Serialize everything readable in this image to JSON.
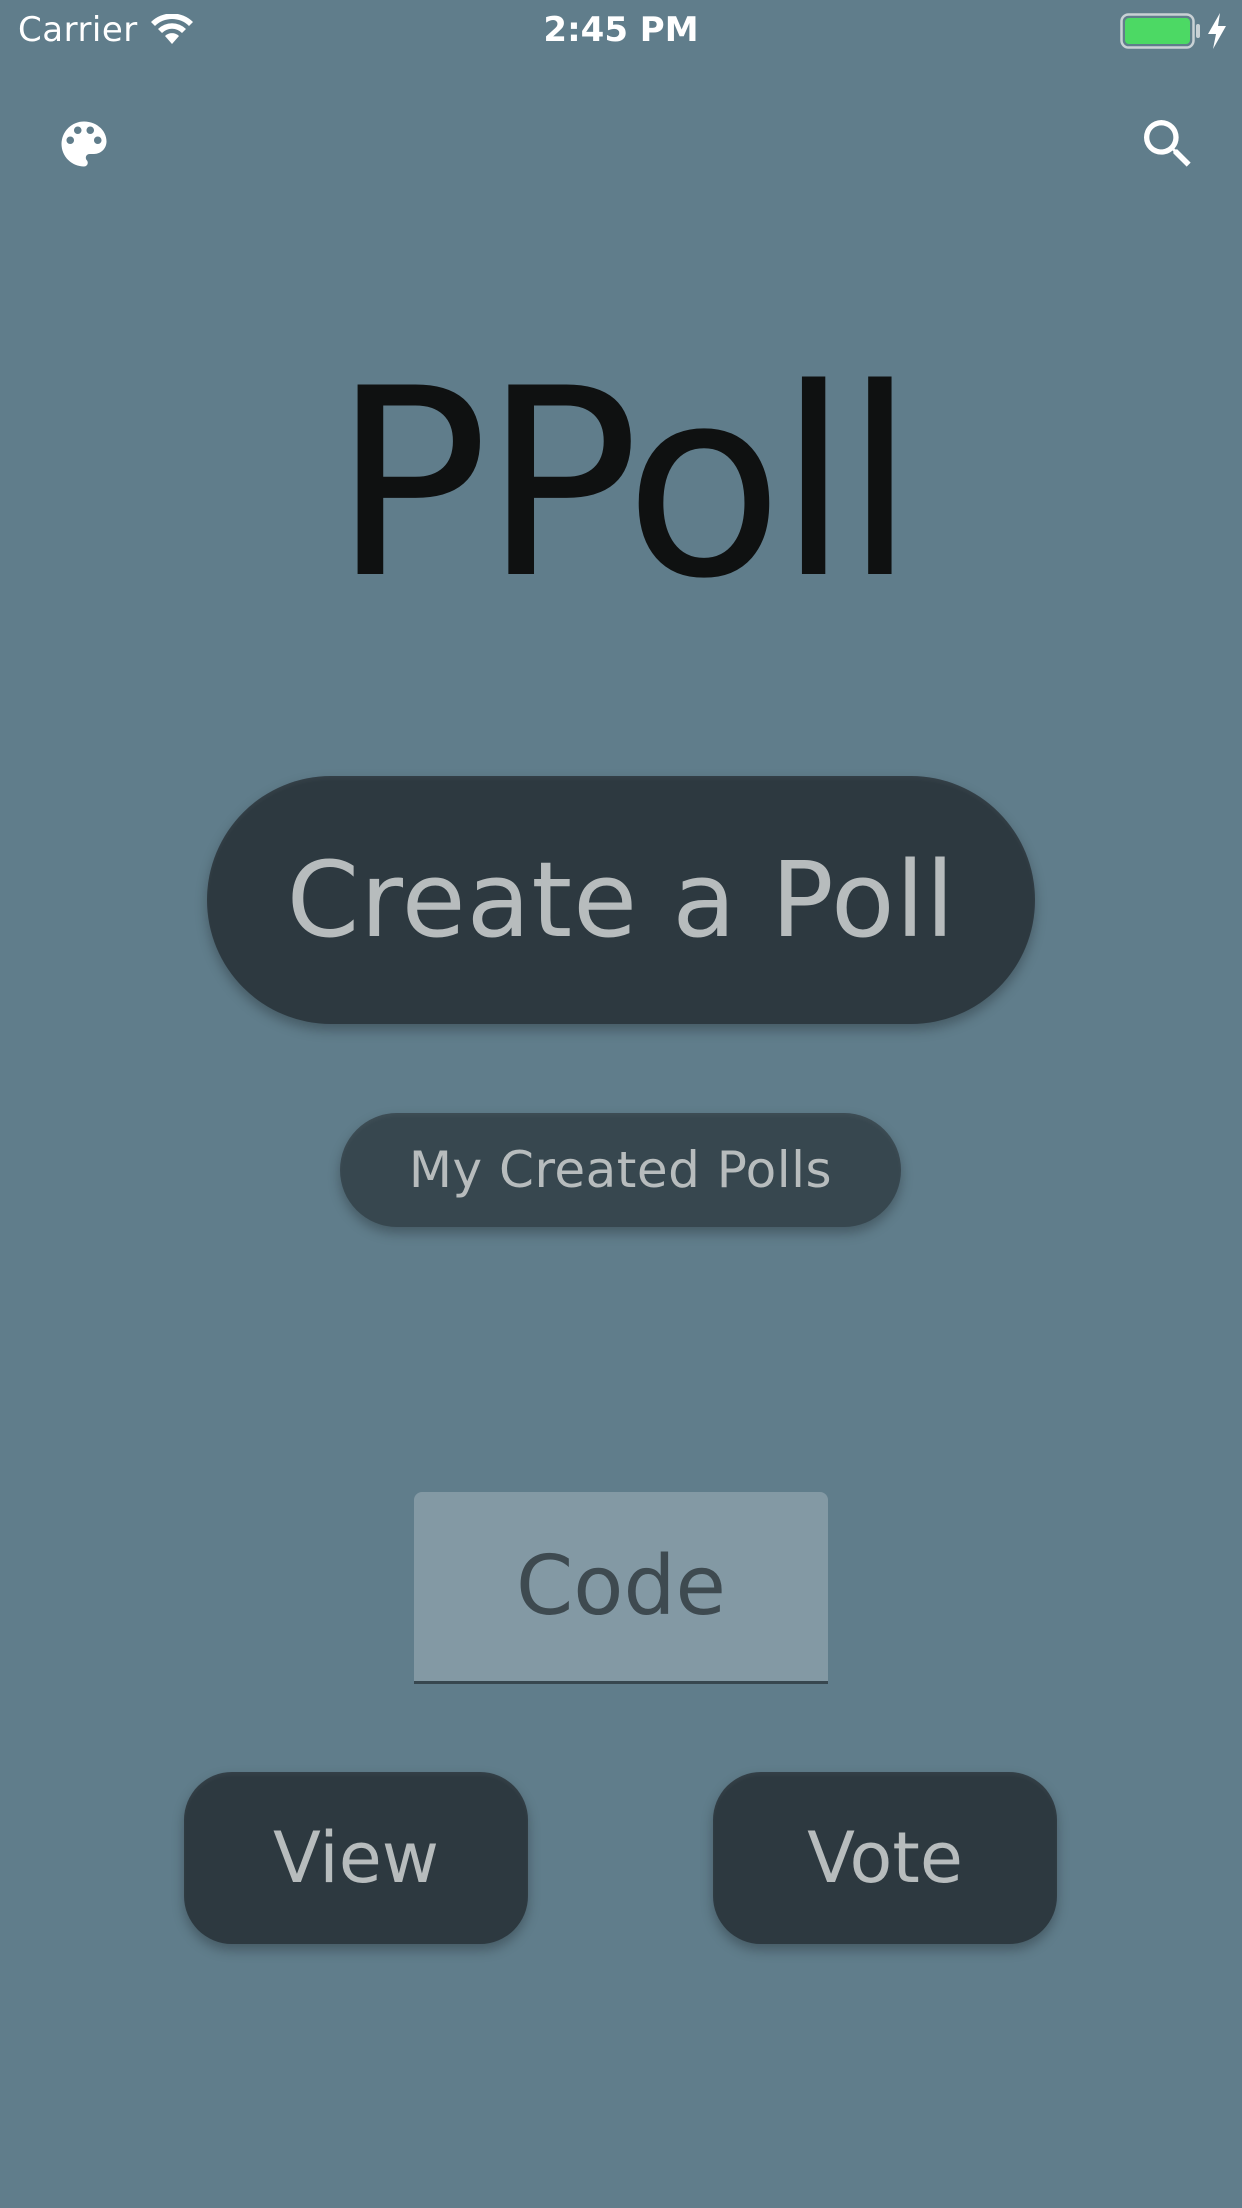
{
  "status_bar": {
    "carrier": "Carrier",
    "time": "2:45 PM",
    "battery_color": "#4cd964"
  },
  "toolbar": {
    "left_icon": "palette-icon",
    "right_icon": "search-icon"
  },
  "app": {
    "title": "PPoll"
  },
  "buttons": {
    "create_poll": "Create a Poll",
    "my_created_polls": "My Created Polls",
    "view": "View",
    "vote": "Vote"
  },
  "code_input": {
    "placeholder": "Code",
    "value": ""
  },
  "colors": {
    "background": "#607d8b",
    "button": "#2d3940",
    "button_text": "#b7bcbd",
    "title": "#0f1111",
    "input_fill": "#8399a4"
  }
}
